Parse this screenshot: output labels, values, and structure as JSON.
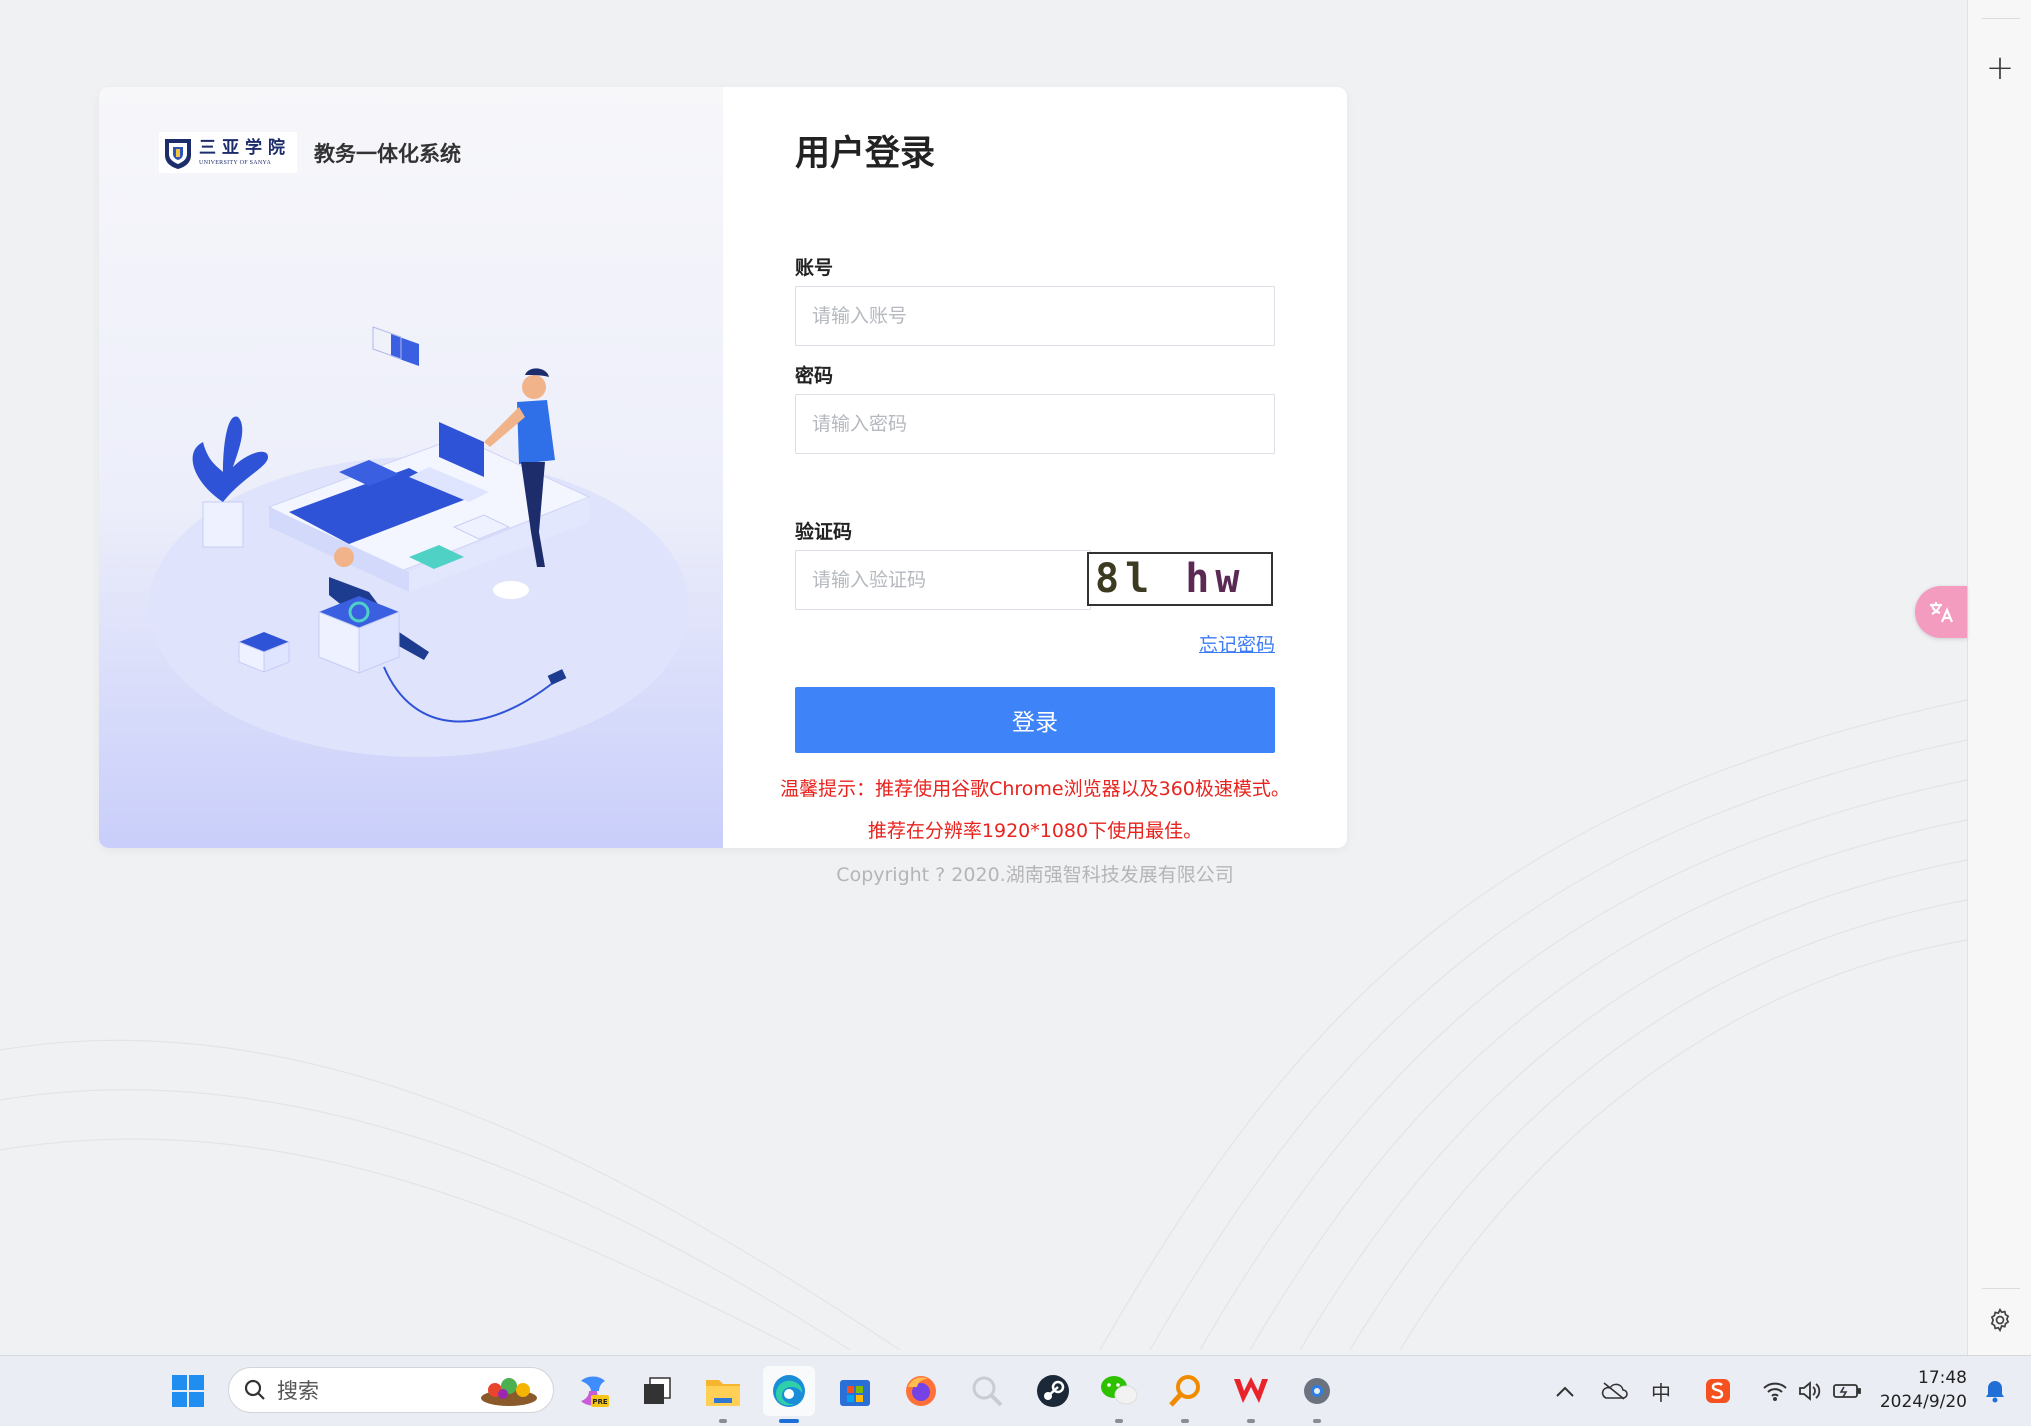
{
  "login": {
    "system_name": "教务一体化系统",
    "logo": {
      "cn": "三亚学院",
      "en": "UNIVERSITY OF SANYA"
    },
    "title": "用户登录",
    "account_label": "账号",
    "account_placeholder": "请输入账号",
    "account_value": "",
    "password_label": "密码",
    "password_placeholder": "请输入密码",
    "password_value": "",
    "captcha_label": "验证码",
    "captcha_placeholder": "请输入验证码",
    "captcha_value": "",
    "captcha_text": "8l hw",
    "forgot_password": "忘记密码",
    "login_button": "登录",
    "tip_line1": "温馨提示：推荐使用谷歌Chrome浏览器以及360极速模式。",
    "tip_line2": "推荐在分辨率1920*1080下使用最佳。",
    "copyright": "Copyright ? 2020.湖南强智科技发展有限公司"
  },
  "browser_sidebar": {
    "new_tab_icon": "plus-icon",
    "settings_icon": "gear-icon",
    "translate_icon": "translate-icon"
  },
  "taskbar": {
    "search_label": "搜索",
    "apps": [
      {
        "name": "start",
        "icon": "windows-icon"
      },
      {
        "name": "copilot",
        "icon": "copilot-icon"
      },
      {
        "name": "task-view",
        "icon": "task-view-icon"
      },
      {
        "name": "file-explorer",
        "icon": "folder-icon"
      },
      {
        "name": "edge",
        "icon": "edge-icon",
        "active": true
      },
      {
        "name": "store",
        "icon": "store-icon"
      },
      {
        "name": "firefox",
        "icon": "firefox-icon"
      },
      {
        "name": "search-app",
        "icon": "magnifier-icon"
      },
      {
        "name": "steam",
        "icon": "steam-icon"
      },
      {
        "name": "wechat",
        "icon": "wechat-icon"
      },
      {
        "name": "everything",
        "icon": "search-tool-icon"
      },
      {
        "name": "wps",
        "icon": "wps-icon"
      },
      {
        "name": "settings",
        "icon": "settings-icon"
      }
    ],
    "tray": {
      "ime": "中",
      "time": "17:48",
      "date": "2024/9/20"
    }
  },
  "colors": {
    "primary": "#3f83f8",
    "link": "#3b7cf5",
    "tip": "#e8231e"
  }
}
